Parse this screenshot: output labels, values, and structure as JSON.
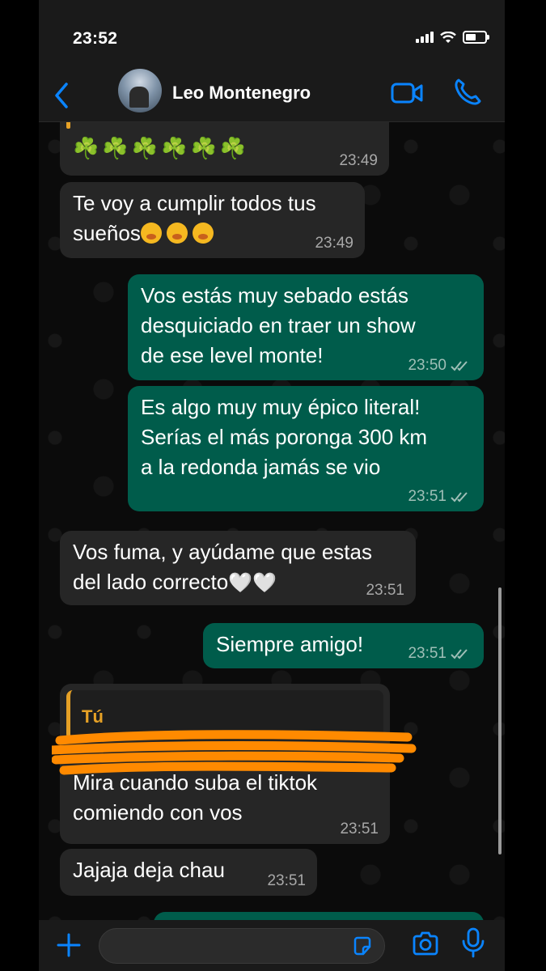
{
  "status_bar": {
    "time": "23:52"
  },
  "header": {
    "contact_name": "Leo Montenegro"
  },
  "messages": [
    {
      "from": "contact",
      "text": "☘️☘️☘️☘️☘️☘️",
      "time": "23:49"
    },
    {
      "from": "contact",
      "text": "Te voy a cumplir todos tus sueños🥱🥱🥱",
      "line1": "Te voy a cumplir todos tus",
      "line2": "sueños",
      "time": "23:49"
    },
    {
      "from": "me",
      "line1": "Vos estás muy sebado estás",
      "line2": "desquiciado en traer un show",
      "line3": "de ese level monte!",
      "time": "23:50"
    },
    {
      "from": "me",
      "line1": "Es algo muy muy épico literal!",
      "line2": "Serías el más poronga 300 km",
      "line3": "a la redonda jamás se vio",
      "time": "23:51"
    },
    {
      "from": "contact",
      "line1": "Vos fuma, y ayúdame que estas",
      "line2": "del lado correcto",
      "hearts": "🤍🤍",
      "time": "23:51"
    },
    {
      "from": "me",
      "text": "Siempre amigo!",
      "time": "23:51"
    },
    {
      "from": "contact",
      "reply_to": "Tú",
      "line1": "Mira cuando suba el tiktok",
      "line2": "comiendo con vos",
      "time": "23:51"
    },
    {
      "from": "contact",
      "text": "Jajaja deja chau",
      "time": "23:51"
    }
  ],
  "colors": {
    "incoming": "#262626",
    "outgoing": "#005c4b",
    "accent": "#0a84ff",
    "reply_accent": "#e6a126",
    "scribble": "#ff8a00"
  },
  "icons": [
    "back-chevron-icon",
    "video-call-icon",
    "phone-icon",
    "plus-icon",
    "sticker-icon",
    "camera-icon",
    "mic-icon",
    "double-check-icon"
  ]
}
